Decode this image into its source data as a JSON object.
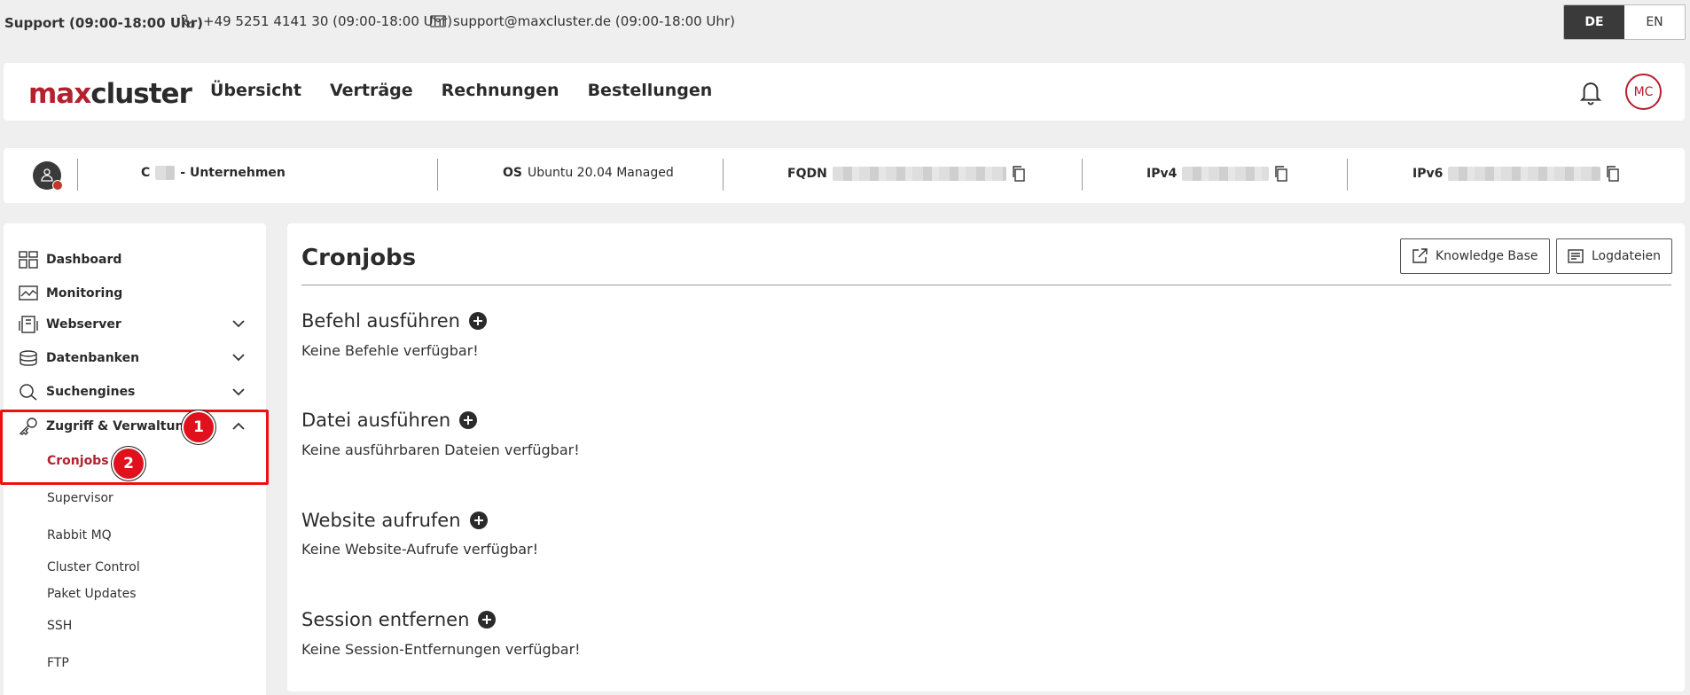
{
  "support": {
    "title": "Support (09:00-18:00 Uhr)",
    "phone": "+49 5251 4141 30 (09:00-18:00 Uhr)",
    "email": "support@maxcluster.de (09:00-18:00 Uhr)"
  },
  "language": {
    "de": "DE",
    "en": "EN",
    "active": "DE"
  },
  "header": {
    "logo_max": "max",
    "logo_cluster": "cluster",
    "nav": [
      "Übersicht",
      "Verträge",
      "Rechnungen",
      "Bestellungen"
    ],
    "avatar_initials": "MC"
  },
  "server": {
    "customer_prefix": "C",
    "customer_suffix": "-  Unternehmen",
    "os_label": "OS",
    "os_value": "Ubuntu 20.04 Managed",
    "fqdn_label": "FQDN",
    "ipv4_label": "IPv4",
    "ipv6_label": "IPv6"
  },
  "sidebar": {
    "items": [
      {
        "label": "Dashboard",
        "icon": "dashboard-icon"
      },
      {
        "label": "Monitoring",
        "icon": "monitoring-icon"
      },
      {
        "label": "Webserver",
        "icon": "webserver-icon",
        "expandable": true
      },
      {
        "label": "Datenbanken",
        "icon": "database-icon",
        "expandable": true
      },
      {
        "label": "Suchengines",
        "icon": "search-icon",
        "expandable": true
      },
      {
        "label": "Zugriff & Verwaltung",
        "icon": "key-icon",
        "expanded": true
      }
    ],
    "subitems": [
      "Cronjobs",
      "Supervisor",
      "Rabbit MQ",
      "Cluster Control",
      "Paket Updates",
      "SSH",
      "FTP"
    ],
    "active_subitem": "Cronjobs"
  },
  "markers": {
    "one": "1",
    "two": "2"
  },
  "content": {
    "title": "Cronjobs",
    "knowledge_base": "Knowledge Base",
    "logfiles": "Logdateien",
    "sections": [
      {
        "title": "Befehl ausführen",
        "empty": "Keine Befehle verfügbar!"
      },
      {
        "title": "Datei ausführen",
        "empty": "Keine ausführbaren Dateien verfügbar!"
      },
      {
        "title": "Website aufrufen",
        "empty": "Keine Website-Aufrufe verfügbar!"
      },
      {
        "title": "Session entfernen",
        "empty": "Keine Session-Entfernungen verfügbar!"
      }
    ]
  },
  "colors": {
    "brand_red": "#b5202e",
    "marker_red": "#e0101c",
    "dark": "#2b2b2b"
  }
}
